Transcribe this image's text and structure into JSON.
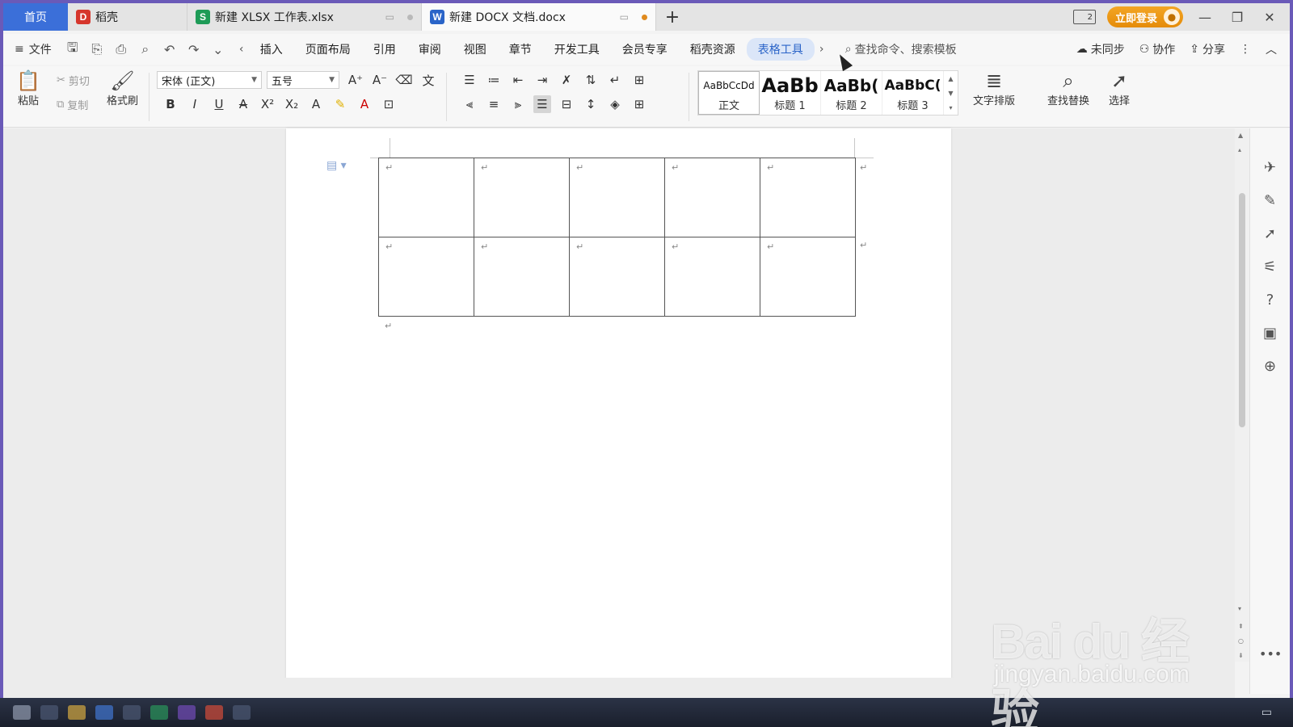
{
  "tabs": {
    "home": "首页",
    "items": [
      {
        "label": "稻壳",
        "icon": "daoke-icon",
        "color": "#d6362c",
        "glyph": "D"
      },
      {
        "label": "新建 XLSX 工作表.xlsx",
        "icon": "spreadsheet-icon",
        "color": "#1e9b57",
        "glyph": "S"
      },
      {
        "label": "新建 DOCX 文档.docx",
        "icon": "word-doc-icon",
        "color": "#2a64c8",
        "glyph": "W",
        "active": true
      }
    ],
    "add": "+",
    "layout_badge": "2",
    "login": "立即登录"
  },
  "menubar": {
    "file": "文件",
    "items": [
      "插入",
      "页面布局",
      "引用",
      "审阅",
      "视图",
      "章节",
      "开发工具",
      "会员专享",
      "稻壳资源",
      "表格工具"
    ],
    "active_index": 9,
    "command_search": "查找命令、搜索模板",
    "sync": "未同步",
    "collab": "协作",
    "share": "分享"
  },
  "ribbon": {
    "paste": "粘贴",
    "cut": "剪切",
    "copy": "复制",
    "format_painter": "格式刷",
    "font_name": "宋体 (正文)",
    "font_size": "五号",
    "styles": [
      {
        "preview": "AaBbCcDd",
        "name": "正文"
      },
      {
        "preview": "AaBb",
        "name": "标题 1"
      },
      {
        "preview": "AaBb(",
        "name": "标题 2"
      },
      {
        "preview": "AaBbC(",
        "name": "标题 3"
      }
    ],
    "text_layout": "文字排版",
    "find_replace": "查找替换",
    "select": "选择"
  },
  "document": {
    "table": {
      "rows": 2,
      "cols": 5,
      "cell_mark": "↵"
    },
    "para_mark": "↵"
  },
  "watermark": {
    "brand": "Bai du 经验",
    "url": "jingyan.baidu.com"
  },
  "colors": {
    "accent": "#3b6fd9",
    "login": "#e8920f",
    "active_menu_bg": "#dbe6f8"
  }
}
